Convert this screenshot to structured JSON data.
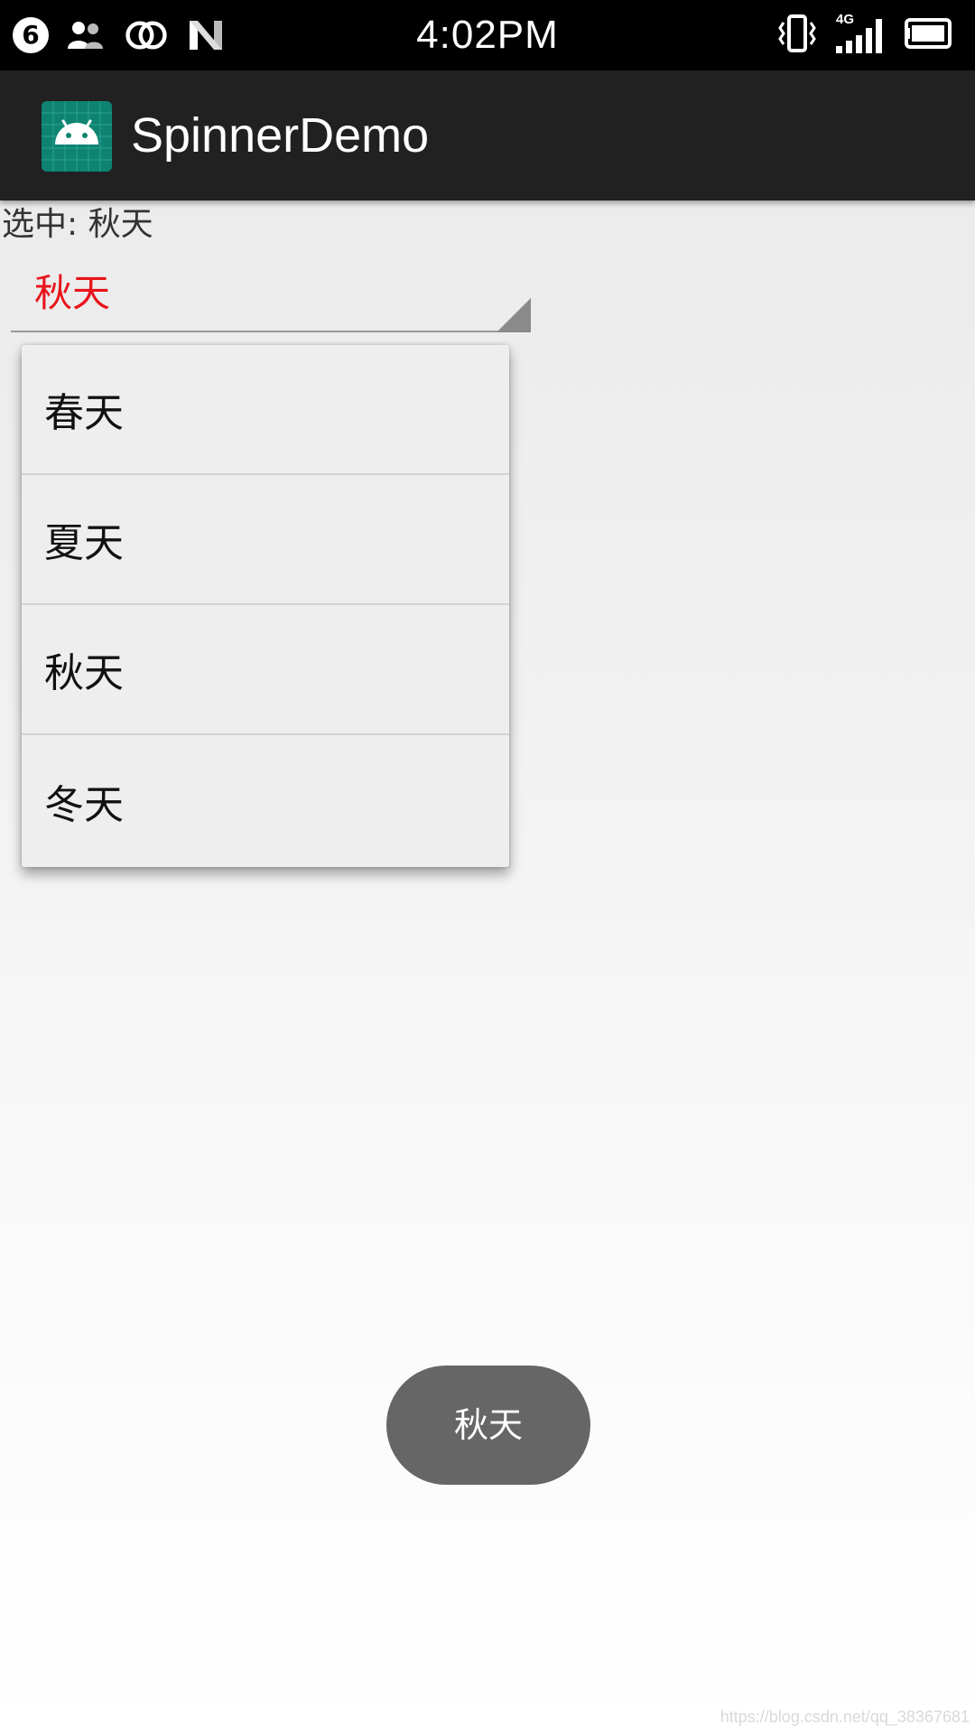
{
  "status_bar": {
    "notification_count": "6",
    "time": "4:02PM",
    "network_type": "4G",
    "icons": [
      "notification-badge",
      "contacts-icon",
      "linked-circles-icon",
      "n-icon",
      "vibrate-icon",
      "signal-icon",
      "battery-icon"
    ]
  },
  "action_bar": {
    "app_icon": "android-app-icon",
    "title": "SpinnerDemo"
  },
  "content": {
    "selected_label": "选中: 秋天",
    "spinner_value": "秋天",
    "spinner_value_color": "#e8141a"
  },
  "dropdown": {
    "items": [
      {
        "label": "春天"
      },
      {
        "label": "夏天"
      },
      {
        "label": "秋天"
      },
      {
        "label": "冬天"
      }
    ]
  },
  "toast": {
    "text": "秋天"
  },
  "watermark": "https://blog.csdn.net/qq_38367681"
}
